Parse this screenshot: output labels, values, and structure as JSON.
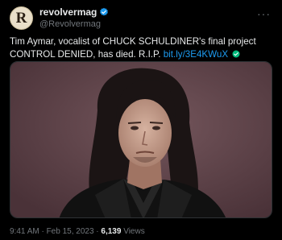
{
  "author": {
    "display_name": "revolvermag",
    "handle": "@Revolvermag",
    "avatar_letter": "R",
    "verified": true,
    "verified_icon": "verified-badge-icon",
    "verified_color": "#1d9bf0"
  },
  "more_icon": "more-options-icon",
  "tweet": {
    "text": "Tim Aymar, vocalist of CHUCK SCHULDINER's final project CONTROL DENIED, has died. R.I.P.",
    "link_text": "bit.ly/3E4KWuX",
    "link_icon": "check-circle-icon",
    "link_icon_color": "#00ba7c"
  },
  "media": {
    "type": "photo",
    "background_color": "#5a3f46"
  },
  "meta": {
    "time": "9:41 AM · Feb 15, 2023 · ",
    "views_count": "6,139",
    "views_label": " Views"
  },
  "colors": {
    "background": "#000000",
    "text": "#e7e9ea",
    "muted": "#71767b",
    "link": "#1d9bf0"
  }
}
